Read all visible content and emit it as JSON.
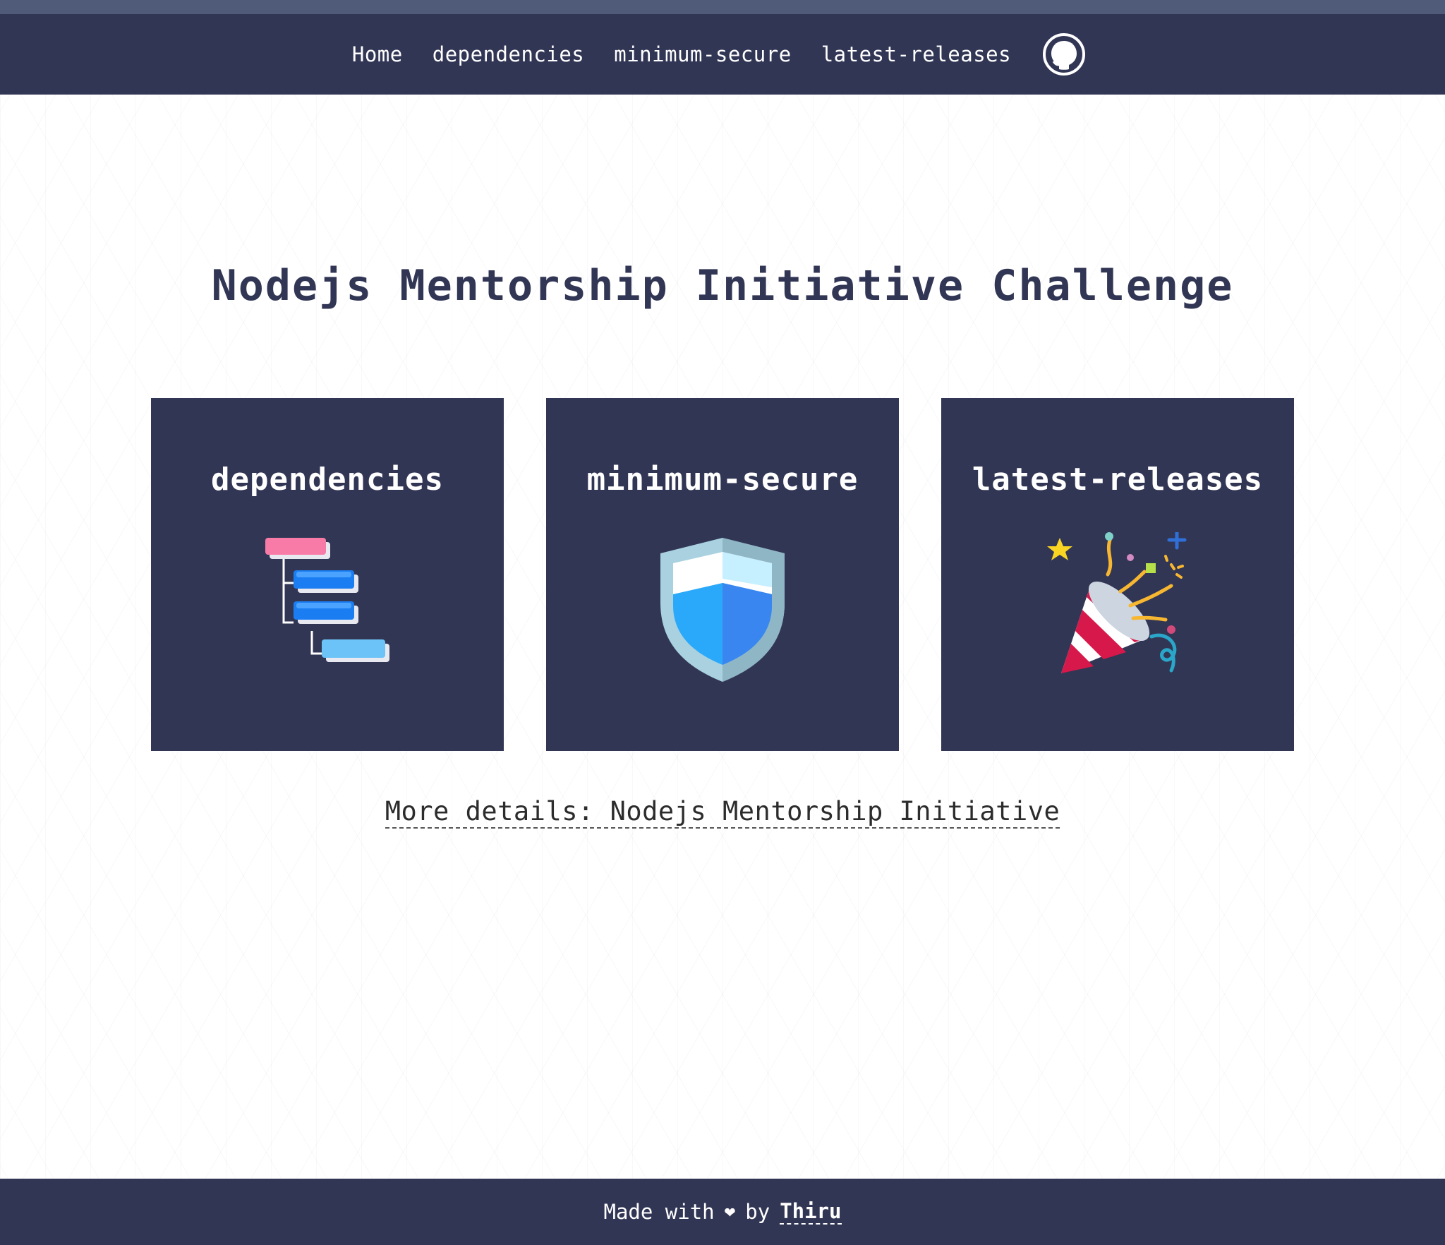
{
  "nav": {
    "links": [
      {
        "label": "Home"
      },
      {
        "label": "dependencies"
      },
      {
        "label": "minimum-secure"
      },
      {
        "label": "latest-releases"
      }
    ],
    "github_icon": "github-icon"
  },
  "main": {
    "title": "Nodejs Mentorship Initiative Challenge",
    "cards": [
      {
        "title": "dependencies",
        "icon": "dependency-tree-icon"
      },
      {
        "title": "minimum-secure",
        "icon": "shield-icon"
      },
      {
        "title": "latest-releases",
        "icon": "party-popper-icon"
      }
    ],
    "more_details": "More details: Nodejs Mentorship Initiative"
  },
  "footer": {
    "made_with": "Made with",
    "heart": "❤",
    "by": "by",
    "author": "Thiru"
  },
  "colors": {
    "navy": "#323655",
    "top_strip": "#4f5b79",
    "background": "#ffffff"
  }
}
